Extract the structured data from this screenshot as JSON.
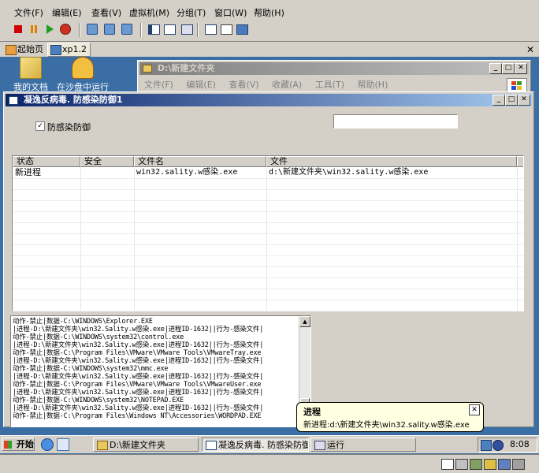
{
  "vmware": {
    "menu": [
      "文件(F)",
      "编辑(E)",
      "查看(V)",
      "虚拟机(M)",
      "分组(T)",
      "窗口(W)",
      "帮助(H)"
    ],
    "tabs": [
      "起始页",
      "xp1.2"
    ]
  },
  "desktop": {
    "icons": [
      "我的文档",
      "在沙盘中运行"
    ]
  },
  "explorer": {
    "title": "D:\\新建文件夹",
    "menu": [
      "文件(F)",
      "编辑(E)",
      "查看(V)",
      "收藏(A)",
      "工具(T)",
      "帮助(H)"
    ]
  },
  "app": {
    "title": "凝逸反病毒. 防感染防御1",
    "checkbox_label": "防感染防御",
    "checkbox_checked": true,
    "search_value": "",
    "columns": [
      "状态",
      "安全",
      "文件名",
      "文件"
    ],
    "rows": [
      [
        "新进程",
        "",
        "win32.sality.w感染.exe",
        "d:\\新建文件夹\\win32.sality.w感染.exe"
      ]
    ],
    "log": [
      "动作-禁止|数据-C:\\WINDOWS\\Explorer.EXE",
      "|进程-D:\\新建文件夹\\win32.Sality.w感染.exe|进程ID-1632||行为-感染文件|",
      "动作-禁止|数据-C:\\WINDOWS\\system32\\control.exe",
      "|进程-D:\\新建文件夹\\win32.Sality.w感染.exe|进程ID-1632||行为-感染文件|",
      "动作-禁止|数据-C:\\Program Files\\VMware\\VMware Tools\\VMwareTray.exe",
      "|进程-D:\\新建文件夹\\win32.Sality.w感染.exe|进程ID-1632||行为-感染文件|",
      "动作-禁止|数据-C:\\WINDOWS\\system32\\mmc.exe",
      "|进程-D:\\新建文件夹\\win32.Sality.w感染.exe|进程ID-1632||行为-感染文件|",
      "动作-禁止|数据-C:\\Program Files\\VMware\\VMware Tools\\VMwareUser.exe",
      "|进程-D:\\新建文件夹\\win32.Sality.w感染.exe|进程ID-1632||行为-感染文件|",
      "动作-禁止|数据-C:\\WINDOWS\\system32\\NOTEPAD.EXE",
      "|进程-D:\\新建文件夹\\win32.Sality.w感染.exe|进程ID-1632||行为-感染文件|",
      "动作-禁止|数据-C:\\Program Files\\Windows NT\\Accessories\\WORDPAD.EXE"
    ]
  },
  "balloon": {
    "title": "进程",
    "text": "新进程:d:\\新建文件夹\\win32.sality.w感染.exe"
  },
  "taskbar": {
    "start": "开始",
    "tasks": [
      "D:\\新建文件夹",
      "凝逸反病毒. 防感染防御1",
      "运行"
    ],
    "clock": "8:08"
  },
  "colors": {
    "desktop": "#3a6ea5",
    "title_active": "#0a246a",
    "title_inactive": "#808080"
  }
}
